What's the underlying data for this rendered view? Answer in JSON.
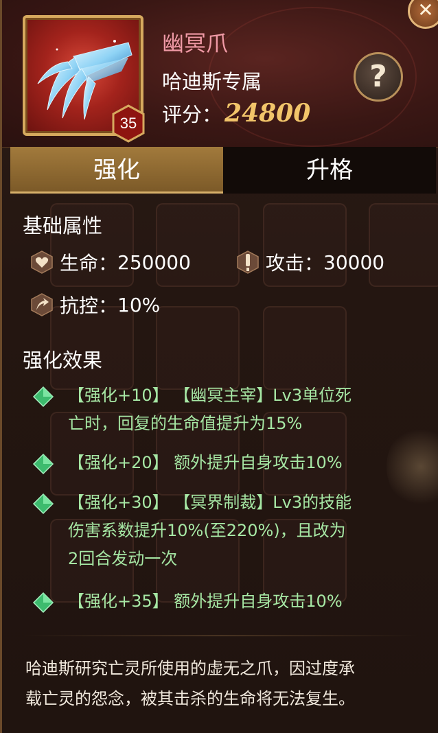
{
  "item": {
    "name": "幽冥爪",
    "exclusive": "哈迪斯专属",
    "score_label": "评分：",
    "score_value": "24800",
    "level": "35"
  },
  "buttons": {
    "close_symbol": "✕",
    "help_symbol": "?"
  },
  "tabs": [
    {
      "label": "强化",
      "active": true
    },
    {
      "label": "升格",
      "active": false
    }
  ],
  "base_attributes": {
    "title": "基础属性",
    "items": [
      {
        "icon": "heart-icon",
        "label": "生命：",
        "value": "250000"
      },
      {
        "icon": "sword-icon",
        "label": "攻击：",
        "value": "30000"
      },
      {
        "icon": "resist-arrow-icon",
        "label": "抗控：",
        "value": "10%"
      }
    ]
  },
  "enhance_effects": {
    "title": "强化效果",
    "items": [
      {
        "lines": [
          "【强化+10】 【幽冥主宰】Lv3单位死",
          "亡时，回复的生命值提升为15%"
        ]
      },
      {
        "lines": [
          "【强化+20】 额外提升自身攻击10%"
        ]
      },
      {
        "lines": [
          "【强化+30】 【冥界制裁】Lv3的技能",
          "伤害系数提升10%(至220%)，且改为",
          "2回合发动一次"
        ]
      },
      {
        "lines": [
          "【强化+35】 额外提升自身攻击10%"
        ]
      }
    ]
  },
  "description": {
    "lines": [
      "哈迪斯研究亡灵所使用的虚无之爪，因过度承",
      "载亡灵的怨念，被其击杀的生命将无法复生。"
    ]
  },
  "colors": {
    "name": "#f09aa6",
    "score": "#f2c56a",
    "effect_text": "#a6e7a4",
    "tab_active": "#8b6530"
  }
}
